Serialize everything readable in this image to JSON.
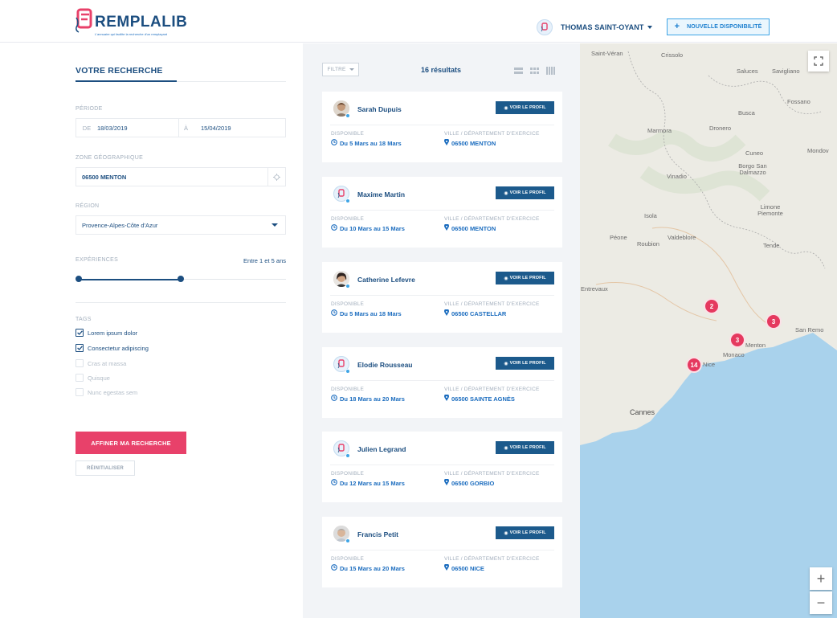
{
  "header": {
    "brand": "REMPLALIB",
    "tagline": "L'annuaire qui facilite la recherche d'un remplaçant",
    "user_name": "THOMAS SAINT-OYANT",
    "new_button": "NOUVELLE DISPONIBILITÉ"
  },
  "search": {
    "title": "VOTRE RECHERCHE",
    "period_label": "PÉRIODE",
    "from_prefix": "DE",
    "from_date": "18/03/2019",
    "to_prefix": "À",
    "to_date": "15/04/2019",
    "zone_label": "ZONE GÉOGRAPHIQUE",
    "zone_value": "06500 MENTON",
    "region_label": "RÉGION",
    "region_value": "Provence-Alpes-Côte d'Azur",
    "experience_label": "EXPÉRIENCES",
    "experience_value": "Entre 1 et 5 ans",
    "experience_range": [
      1,
      5
    ],
    "tags_label": "TAGS",
    "tags": [
      {
        "label": "Lorem ipsum dolor",
        "checked": true
      },
      {
        "label": "Consectetur adipiscing",
        "checked": true
      },
      {
        "label": "Cras at massa",
        "checked": false
      },
      {
        "label": "Quisque",
        "checked": false
      },
      {
        "label": "Nunc egestas sem",
        "checked": false
      }
    ],
    "refine_button": "AFFINER MA RECHERCHE",
    "reset_button": "RÉINITIALISER"
  },
  "results": {
    "filter_label": "FILTRE",
    "count": "16 résultats",
    "profile_button": "VOIR LE PROFIL",
    "available_label": "DISPONIBLE",
    "city_label": "VILLE / DÉPARTEMENT D'EXERCICE",
    "items": [
      {
        "name": "Sarah Dupuis",
        "avatar": "photo",
        "dates": "Du 5 Mars au 18 Mars",
        "city": "06500 MENTON"
      },
      {
        "name": "Maxime Martin",
        "avatar": "logo",
        "dates": "Du 10 Mars au 15 Mars",
        "city": "06500 MENTON"
      },
      {
        "name": "Catherine Lefevre",
        "avatar": "photo",
        "dates": "Du 5 Mars au 18 Mars",
        "city": "06500 CASTELLAR"
      },
      {
        "name": "Elodie Rousseau",
        "avatar": "logo",
        "dates": "Du 18 Mars au 20 Mars",
        "city": "06500 SAINTE AGNÈS"
      },
      {
        "name": "Julien Legrand",
        "avatar": "logo",
        "dates": "Du 12 Mars au 15 Mars",
        "city": "06500 GORBIO"
      },
      {
        "name": "Francis Petit",
        "avatar": "photo",
        "dates": "Du 15 Mars au 20 Mars",
        "city": "06500 NICE"
      }
    ]
  },
  "map": {
    "places": [
      "Saint-Véran",
      "Crissolo",
      "Saluces",
      "Savigliano",
      "Fossano",
      "Busca",
      "Marmora",
      "Dronero",
      "Cuneo",
      "Mondov",
      "Borgo San Dalmazzo",
      "Vinadio",
      "Isola",
      "Limone Piemonte",
      "Péone",
      "Roubion",
      "Valdeblore",
      "Tende",
      "Entrevaux",
      "San Remo",
      "Menton",
      "Monaco",
      "Cannes",
      "Nice"
    ],
    "clusters": [
      {
        "id": "c1",
        "count": "2"
      },
      {
        "id": "c2",
        "count": "3"
      },
      {
        "id": "c3",
        "count": "3"
      },
      {
        "id": "c4",
        "count": "14"
      }
    ],
    "zoom_in": "+",
    "zoom_out": "−"
  },
  "colors": {
    "primary": "#1c4e80",
    "accent": "#e8416a",
    "link": "#1c6dbf",
    "sea": "#a9d2ec"
  }
}
